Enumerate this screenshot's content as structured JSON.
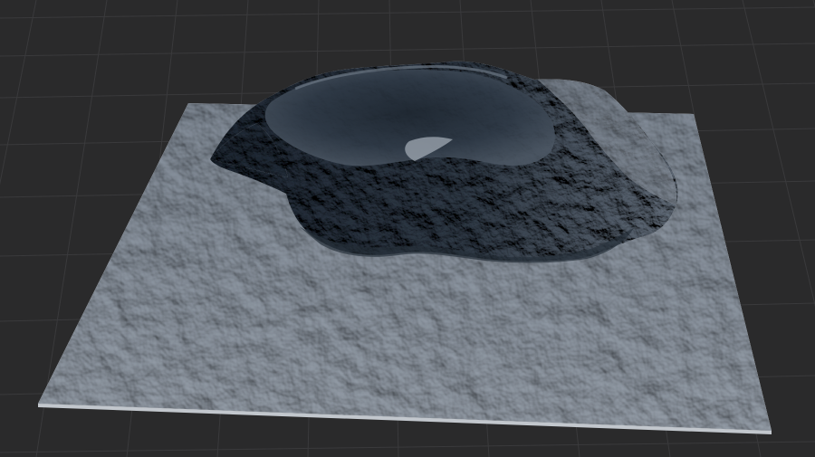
{
  "viewport": {
    "background_color": "#2a2a2b",
    "grid_color": "#3a3a3c",
    "terrain_base_color": "#a7aeb6",
    "terrain_shadow_color": "#2c3642",
    "terrain_highlight_color": "#c9ced4"
  },
  "icons": {
    "terrain": "terrain-mesh",
    "grid": "ground-grid"
  }
}
